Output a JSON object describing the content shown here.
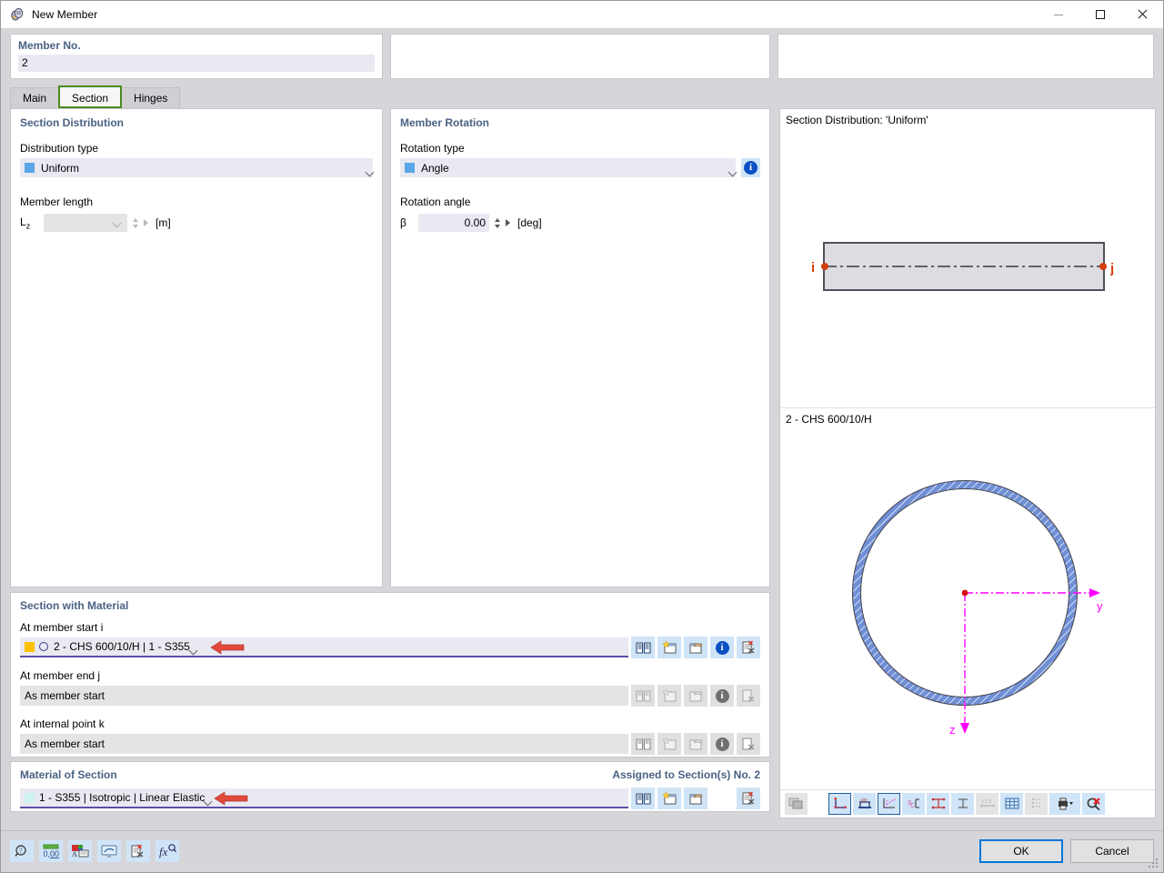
{
  "window": {
    "title": "New Member",
    "app_icon": "member-icon",
    "minimize": "minimize-icon",
    "maximize": "maximize-icon",
    "close": "close-icon"
  },
  "header": {
    "member_no_label": "Member No.",
    "member_no_value": "2"
  },
  "tabs": [
    {
      "label": "Main",
      "active": false
    },
    {
      "label": "Section",
      "active": true
    },
    {
      "label": "Hinges",
      "active": false
    }
  ],
  "section_distribution": {
    "group_title": "Section Distribution",
    "distribution_type_label": "Distribution type",
    "distribution_type_value": "Uniform",
    "member_length_label": "Member length",
    "member_length_symbol": "L",
    "member_length_subscript": "z",
    "member_length_value": "",
    "member_length_unit": "[m]"
  },
  "member_rotation": {
    "group_title": "Member Rotation",
    "rotation_type_label": "Rotation type",
    "rotation_type_value": "Angle",
    "rotation_angle_label": "Rotation angle",
    "rotation_angle_symbol": "β",
    "rotation_angle_value": "0.00",
    "rotation_angle_unit": "[deg]",
    "info_badge": "i"
  },
  "section_with_material": {
    "group_title": "Section with Material",
    "rows": [
      {
        "label": "At member start i",
        "value": "2 - CHS 600/10/H | 1 - S355",
        "swatch_color": "#ffc000",
        "has_circle_icon": true,
        "enabled": true,
        "has_arrow": true,
        "buttons": [
          "library-icon",
          "new-icon",
          "edit-icon",
          "info-icon",
          "delete-icon"
        ]
      },
      {
        "label": "At member end j",
        "value": "As member start",
        "swatch_color": "",
        "has_circle_icon": false,
        "enabled": false,
        "has_arrow": false,
        "buttons": [
          "library-icon",
          "new-icon",
          "edit-icon",
          "info-icon",
          "delete-icon"
        ]
      },
      {
        "label": "At internal point k",
        "value": "As member start",
        "swatch_color": "",
        "has_circle_icon": false,
        "enabled": false,
        "has_arrow": false,
        "buttons": [
          "library-icon",
          "new-icon",
          "edit-icon",
          "info-icon",
          "delete-icon"
        ]
      }
    ]
  },
  "material_of_section": {
    "group_title": "Material of Section",
    "assigned_label": "Assigned to Section(s) No. 2",
    "value": "1 - S355 | Isotropic | Linear Elastic",
    "swatch_color": "#cdf2f0",
    "has_arrow": true,
    "buttons": [
      "library-icon",
      "new-icon",
      "edit-icon",
      "delete-icon"
    ]
  },
  "graphics": {
    "distribution_caption": "Section Distribution: 'Uniform'",
    "node_start_label": "i",
    "node_end_label": "j",
    "section_caption": "2 - CHS 600/10/H",
    "axis_y_label": "y",
    "axis_z_label": "z",
    "axis_color": "#ff00ff",
    "section_color": "#6f8fd6",
    "toolbar": [
      {
        "name": "render-thumbnail-icon",
        "state": "disabled"
      },
      {
        "name": "show-dimensions-icon",
        "state": "selected"
      },
      {
        "name": "show-stirrups-icon",
        "state": "normal"
      },
      {
        "name": "show-axes-icon",
        "state": "selected"
      },
      {
        "name": "show-shear-center-icon",
        "state": "normal"
      },
      {
        "name": "show-height-dimension-icon",
        "state": "normal"
      },
      {
        "name": "show-section-outline-icon",
        "state": "normal"
      },
      {
        "name": "show-numbering-icon",
        "state": "disabled"
      },
      {
        "name": "show-grid-icon",
        "state": "normal"
      },
      {
        "name": "show-points-icon",
        "state": "disabled"
      },
      {
        "name": "print-icon",
        "state": "normal"
      },
      {
        "name": "reset-zoom-icon",
        "state": "normal"
      }
    ]
  },
  "bottom_bar": {
    "left_buttons": [
      "help-search-icon",
      "decimal-places-icon",
      "display-properties-icon",
      "view-mode-icon",
      "delete-record-icon",
      "formula-icon"
    ],
    "ok_label": "OK",
    "cancel_label": "Cancel"
  }
}
